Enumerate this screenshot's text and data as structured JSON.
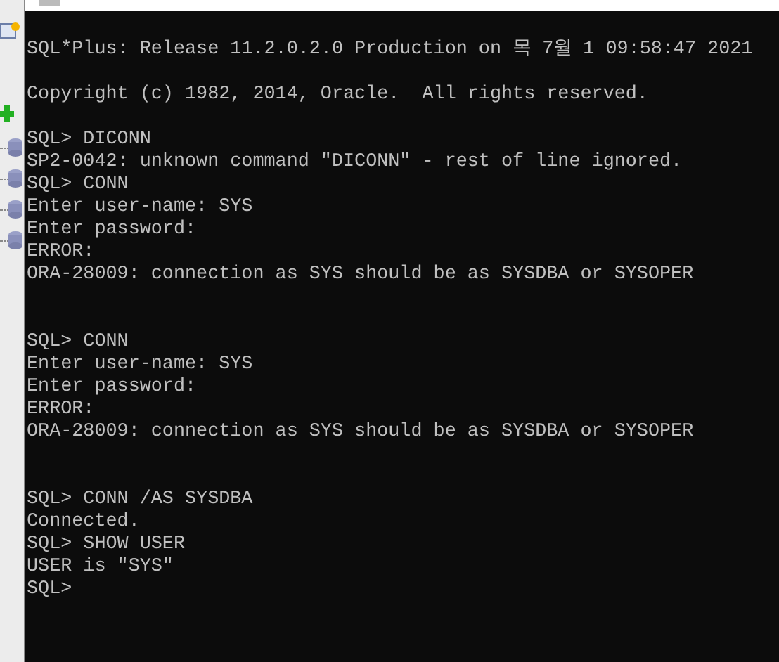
{
  "sidebar": {
    "items": [
      {
        "kind": "db"
      },
      {
        "kind": "db"
      },
      {
        "kind": "db"
      },
      {
        "kind": "db"
      }
    ]
  },
  "console": {
    "lines": [
      {
        "kind": "blank"
      },
      {
        "kind": "text",
        "text": "SQL*Plus: Release 11.2.0.2.0 Production on 목 7월 1 09:58:47 2021"
      },
      {
        "kind": "blank"
      },
      {
        "kind": "text",
        "text": "Copyright (c) 1982, 2014, Oracle.  All rights reserved."
      },
      {
        "kind": "blank"
      },
      {
        "kind": "text",
        "text": "SQL> DICONN"
      },
      {
        "kind": "text",
        "text": "SP2-0042: unknown command \"DICONN\" - rest of line ignored."
      },
      {
        "kind": "text",
        "text": "SQL> CONN"
      },
      {
        "kind": "text",
        "text": "Enter user-name: SYS"
      },
      {
        "kind": "text",
        "text": "Enter password:"
      },
      {
        "kind": "text",
        "text": "ERROR:"
      },
      {
        "kind": "text",
        "text": "ORA-28009: connection as SYS should be as SYSDBA or SYSOPER"
      },
      {
        "kind": "blank"
      },
      {
        "kind": "blank"
      },
      {
        "kind": "text",
        "text": "SQL> CONN"
      },
      {
        "kind": "text",
        "text": "Enter user-name: SYS"
      },
      {
        "kind": "text",
        "text": "Enter password:"
      },
      {
        "kind": "text",
        "text": "ERROR:"
      },
      {
        "kind": "text",
        "text": "ORA-28009: connection as SYS should be as SYSDBA or SYSOPER"
      },
      {
        "kind": "blank"
      },
      {
        "kind": "blank"
      },
      {
        "kind": "text",
        "text": "SQL> CONN /AS SYSDBA"
      },
      {
        "kind": "text",
        "text": "Connected."
      },
      {
        "kind": "text",
        "text": "SQL> SHOW USER"
      },
      {
        "kind": "text",
        "text": "USER is \"SYS\""
      },
      {
        "kind": "text",
        "text": "SQL>"
      }
    ]
  }
}
